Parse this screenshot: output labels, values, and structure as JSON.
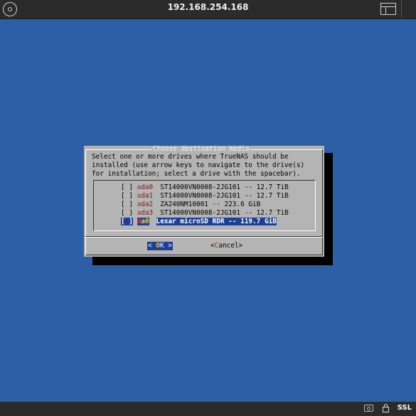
{
  "window": {
    "title": "192.168.254.168",
    "ssl_label": "SSL"
  },
  "dialog": {
    "title": "Choose destination media",
    "prompt_lines": [
      "Select one or more drives where TrueNAS should be",
      "installed (use arrow keys to navigate to the drive(s)",
      "for installation; select a drive with the spacebar)."
    ],
    "drives": [
      {
        "checkbox": "[ ]",
        "name_first": "a",
        "name_rest": "da0",
        "description": "ST14000VN0008-2JG101 -- 12.7 TiB"
      },
      {
        "checkbox": "[ ]",
        "name_first": "a",
        "name_rest": "da1",
        "description": "ST14000VN0008-2JG101 -- 12.7 TiB"
      },
      {
        "checkbox": "[ ]",
        "name_first": "a",
        "name_rest": "da2",
        "description": "ZA240NM10001 -- 223.6 GiB"
      },
      {
        "checkbox": "[ ]",
        "name_first": "a",
        "name_rest": "da3",
        "description": "ST14000VN0008-2JG101 -- 12.7 TiB"
      },
      {
        "checkbox": "[ ]",
        "name_first": "d",
        "name_rest": "a0",
        "description": "Lexar microSD RDR -- 119.7 GiB"
      }
    ],
    "selected_index": 4,
    "ok_button": {
      "left": "< ",
      "hot": "O",
      "rest": "K",
      "right": " >"
    },
    "cancel_button": {
      "left": "<",
      "hot": "C",
      "rest": "ancel",
      "right": ">"
    }
  },
  "icons": {
    "top_left": "disc-icon",
    "top_right": "layout-icon",
    "bottom_camera": "camera-icon",
    "bottom_lock": "lock-icon"
  },
  "colors": {
    "desktop": "#2c5fa6",
    "dialog_bg": "#b4b4b4",
    "highlight": "#1d3f98",
    "hotkey": "#f2d02b"
  }
}
